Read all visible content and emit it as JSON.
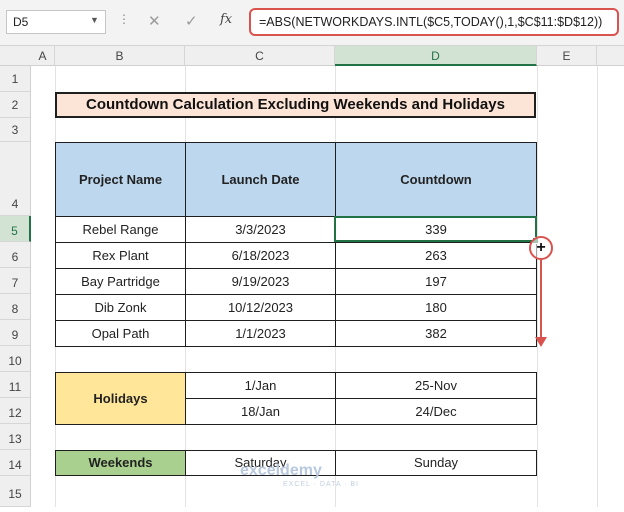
{
  "formula_bar": {
    "name_box": "D5",
    "fx": "fx",
    "formula": "=ABS(NETWORKDAYS.INTL($C5,TODAY(),1,$C$11:$D$12))"
  },
  "columns": [
    "A",
    "B",
    "C",
    "D",
    "E"
  ],
  "rows": [
    "1",
    "2",
    "3",
    "4",
    "5",
    "6",
    "7",
    "8",
    "9",
    "10",
    "11",
    "12",
    "13",
    "14",
    "15"
  ],
  "title": "Countdown Calculation Excluding Weekends and Holidays",
  "table": {
    "headers": [
      "Project Name",
      "Launch Date",
      "Countdown"
    ],
    "rows": [
      [
        "Rebel Range",
        "3/3/2023",
        "339"
      ],
      [
        "Rex Plant",
        "6/18/2023",
        "263"
      ],
      [
        "Bay Partridge",
        "9/19/2023",
        "197"
      ],
      [
        "Dib Zonk",
        "10/12/2023",
        "180"
      ],
      [
        "Opal Path",
        "1/1/2023",
        "382"
      ]
    ]
  },
  "holidays": {
    "label": "Holidays",
    "values": [
      "1/Jan",
      "25-Nov",
      "18/Jan",
      "24/Dec"
    ]
  },
  "weekends": {
    "label": "Weekends",
    "values": [
      "Saturday",
      "Sunday"
    ]
  },
  "watermark": {
    "name": "exceldemy",
    "tagline": "EXCEL · DATA · BI"
  },
  "colors": {
    "header_fill": "#bdd7ee",
    "title_fill": "#fce4d6",
    "holiday_fill": "#ffe699",
    "weekend_fill": "#a9d08e",
    "selection": "#217346",
    "highlight": "#d9534f"
  }
}
